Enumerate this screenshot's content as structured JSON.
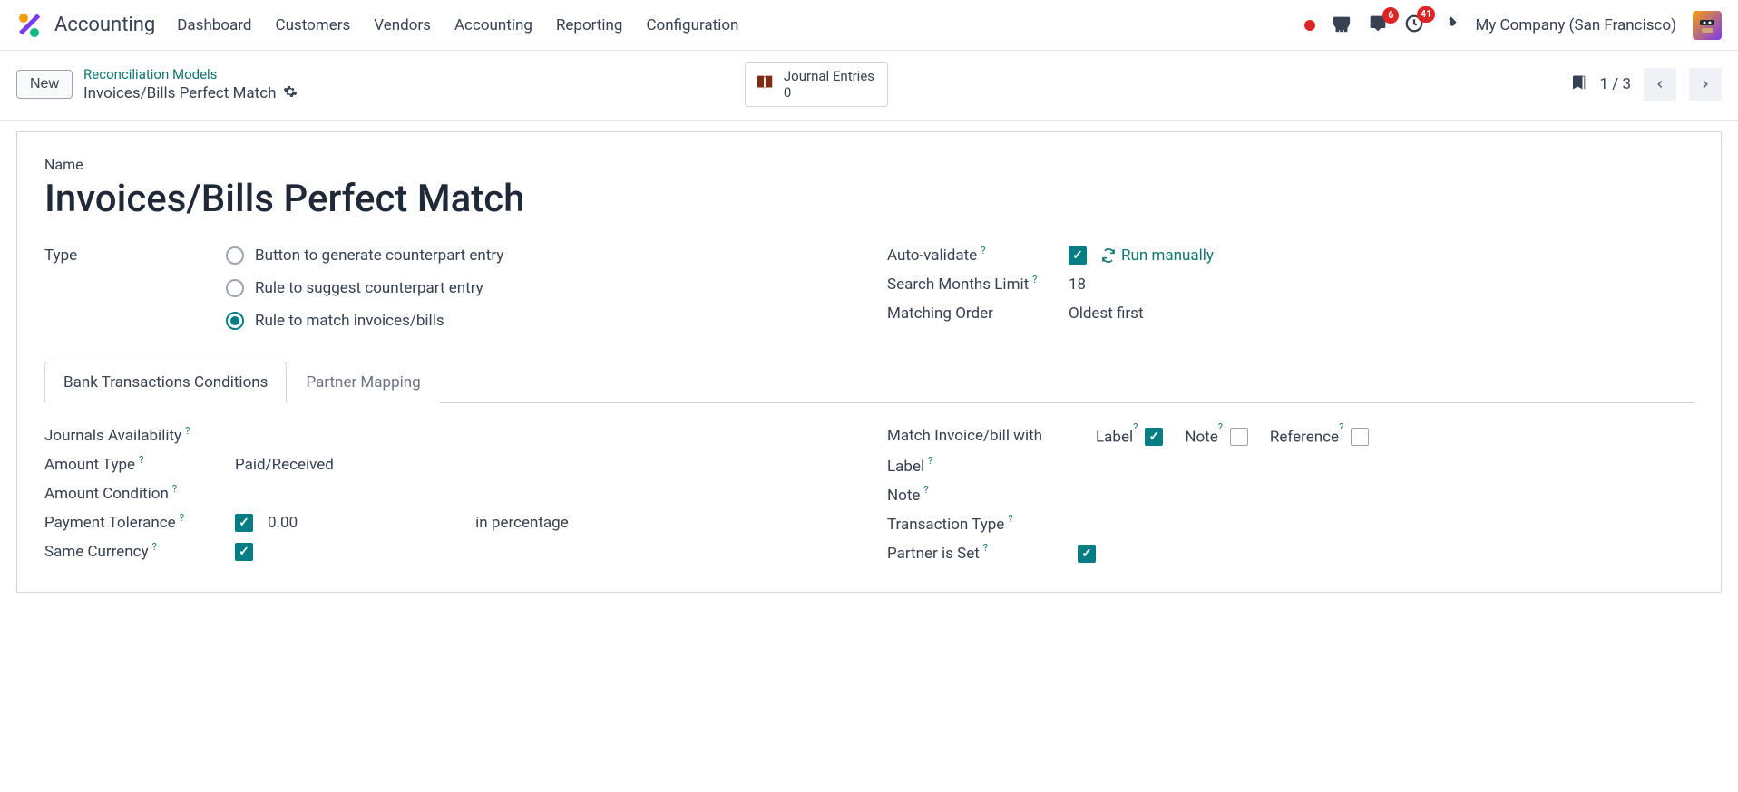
{
  "app": {
    "title": "Accounting"
  },
  "nav": {
    "dashboard": "Dashboard",
    "customers": "Customers",
    "vendors": "Vendors",
    "accounting": "Accounting",
    "reporting": "Reporting",
    "configuration": "Configuration"
  },
  "topbar": {
    "messages_badge": "6",
    "activities_badge": "41",
    "company": "My Company (San Francisco)"
  },
  "controlbar": {
    "new_btn": "New",
    "breadcrumb_parent": "Reconciliation Models",
    "breadcrumb_current": "Invoices/Bills Perfect Match",
    "stat_title": "Journal Entries",
    "stat_count": "0",
    "pager": "1 / 3"
  },
  "form": {
    "name_label": "Name",
    "name_value": "Invoices/Bills Perfect Match",
    "type_label": "Type",
    "type_options": {
      "opt1": "Button to generate counterpart entry",
      "opt2": "Rule to suggest counterpart entry",
      "opt3": "Rule to match invoices/bills"
    },
    "auto_validate_label": "Auto-validate",
    "run_manually": "Run manually",
    "months_label": "Search Months Limit",
    "months_value": "18",
    "matching_order_label": "Matching Order",
    "matching_order_value": "Oldest first"
  },
  "tabs": {
    "tab1": "Bank Transactions Conditions",
    "tab2": "Partner Mapping"
  },
  "tab_content": {
    "journals_label": "Journals Availability",
    "amount_type_label": "Amount Type",
    "amount_type_value": "Paid/Received",
    "amount_condition_label": "Amount Condition",
    "payment_tolerance_label": "Payment Tolerance",
    "payment_tolerance_value": "0.00",
    "payment_tolerance_unit": "in percentage",
    "same_currency_label": "Same Currency",
    "match_with_label": "Match Invoice/bill with",
    "match_label": "Label",
    "match_note": "Note",
    "match_reference": "Reference",
    "label_label": "Label",
    "note_label": "Note",
    "transaction_type_label": "Transaction Type",
    "partner_set_label": "Partner is Set"
  }
}
